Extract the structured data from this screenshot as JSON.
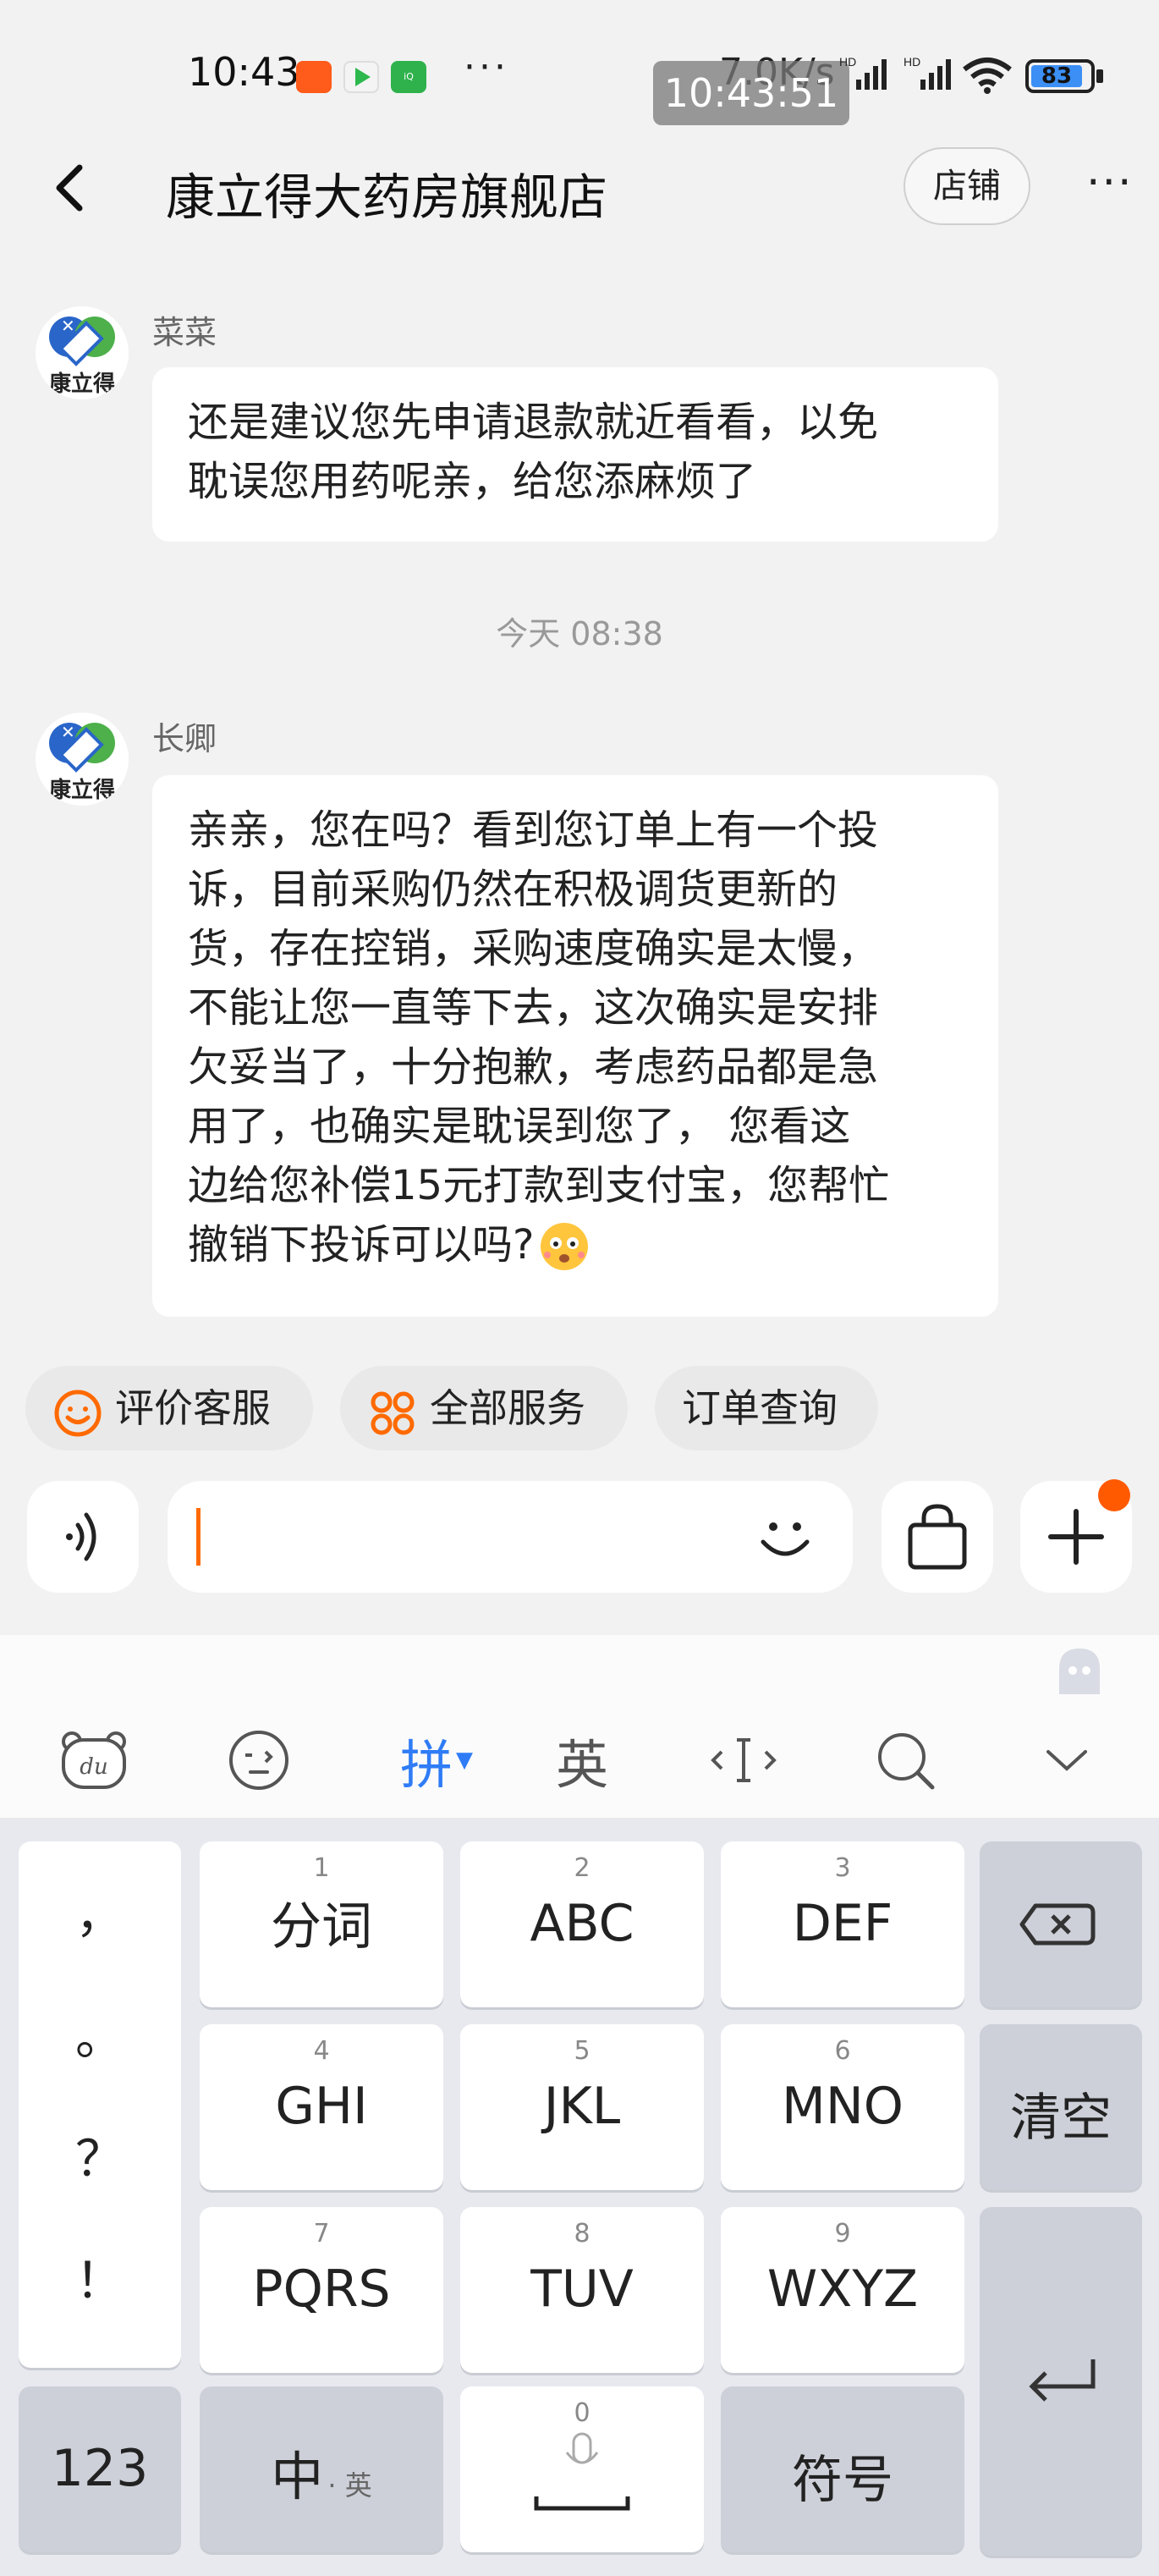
{
  "status_bar": {
    "time": "10:43",
    "dots": "···",
    "net_speed": "7.0K/s",
    "clock_overlay": "10:43:51",
    "hd_1": "HD",
    "hd_2": "HD",
    "battery": "83"
  },
  "header": {
    "title": "康立得大药房旗舰店",
    "shop_button": "店铺",
    "more": "···"
  },
  "messages": [
    {
      "sender": "菜菜",
      "lines": [
        "还是建议您先申请退款就近看看，以免",
        "耽误您用药呢亲，给您添麻烦了"
      ]
    },
    {
      "sender": "长卿",
      "lines": [
        "亲亲，您在吗？看到您订单上有一个投",
        "诉，目前采购仍然在积极调货更新的",
        "货，存在控销，采购速度确实是太慢，",
        "不能让您一直等下去，这次确实是安排",
        "欠妥当了，十分抱歉，考虑药品都是急",
        "用了，也确实是耽误到您了， 您看这",
        "边给您补偿15元打款到支付宝，您帮忙",
        "撤销下投诉可以吗?"
      ]
    }
  ],
  "timestamp": "今天  08:38",
  "avatar_text": "康立得",
  "quick_replies": {
    "rate": "评价客服",
    "services": "全部服务",
    "orders": "订单查询"
  },
  "ime_toolbar": {
    "pinyin": "拼",
    "english": "英"
  },
  "keyboard": {
    "punctuation": [
      "，",
      "。",
      "？",
      "！"
    ],
    "keys": [
      {
        "num": "1",
        "label": "分词"
      },
      {
        "num": "2",
        "label": "ABC"
      },
      {
        "num": "3",
        "label": "DEF"
      },
      {
        "num": "4",
        "label": "GHI"
      },
      {
        "num": "5",
        "label": "JKL"
      },
      {
        "num": "6",
        "label": "MNO"
      },
      {
        "num": "7",
        "label": "PQRS"
      },
      {
        "num": "8",
        "label": "TUV"
      },
      {
        "num": "9",
        "label": "WXYZ"
      }
    ],
    "clear": "清空",
    "num_switch": "123",
    "lang_main": "中",
    "lang_sub": "· 英",
    "space_num": "0",
    "symbols": "符号"
  },
  "colors": {
    "accent": "#ff6a00",
    "ime_active": "#2f7cf6",
    "avatar_blue": "#2a66c9",
    "avatar_green": "#4db04a"
  }
}
